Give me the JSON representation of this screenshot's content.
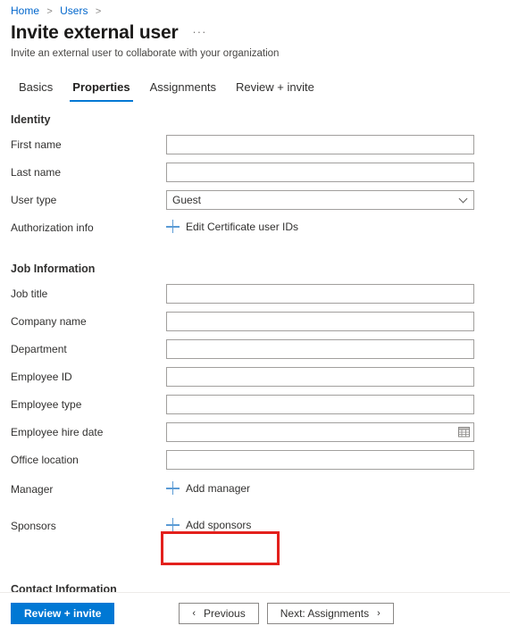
{
  "breadcrumb": {
    "items": [
      {
        "label": "Home"
      },
      {
        "label": "Users"
      }
    ],
    "separator": ">"
  },
  "header": {
    "title": "Invite external user",
    "ellipsis": "···",
    "subtitle": "Invite an external user to collaborate with your organization"
  },
  "tabs": [
    {
      "label": "Basics",
      "active": false
    },
    {
      "label": "Properties",
      "active": true
    },
    {
      "label": "Assignments",
      "active": false
    },
    {
      "label": "Review + invite",
      "active": false
    }
  ],
  "sections": {
    "identity": {
      "heading": "Identity",
      "fields": {
        "first_name": {
          "label": "First name",
          "value": "",
          "placeholder": ""
        },
        "last_name": {
          "label": "Last name",
          "value": "",
          "placeholder": ""
        },
        "user_type": {
          "label": "User type",
          "value": "Guest"
        },
        "authorization_info": {
          "label": "Authorization info",
          "action": "Edit Certificate user IDs"
        }
      }
    },
    "job_information": {
      "heading": "Job Information",
      "fields": {
        "job_title": {
          "label": "Job title",
          "value": "",
          "placeholder": ""
        },
        "company_name": {
          "label": "Company name",
          "value": "",
          "placeholder": ""
        },
        "department": {
          "label": "Department",
          "value": "",
          "placeholder": ""
        },
        "employee_id": {
          "label": "Employee ID",
          "value": "",
          "placeholder": ""
        },
        "employee_type": {
          "label": "Employee type",
          "value": "",
          "placeholder": ""
        },
        "employee_hire_date": {
          "label": "Employee hire date",
          "value": "",
          "placeholder": ""
        },
        "office_location": {
          "label": "Office location",
          "value": "",
          "placeholder": ""
        },
        "manager": {
          "label": "Manager",
          "action": "Add manager"
        },
        "sponsors": {
          "label": "Sponsors",
          "action": "Add sponsors"
        }
      }
    },
    "contact_information": {
      "heading": "Contact Information"
    }
  },
  "footer": {
    "primary": "Review + invite",
    "previous": "Previous",
    "next": "Next: Assignments",
    "chevron_left": "‹",
    "chevron_right": "›"
  },
  "colors": {
    "accent": "#0078d4",
    "link": "#0066cc",
    "highlight": "#e3201c",
    "plus": "#5b9bd5",
    "border": "#a19f9d"
  }
}
